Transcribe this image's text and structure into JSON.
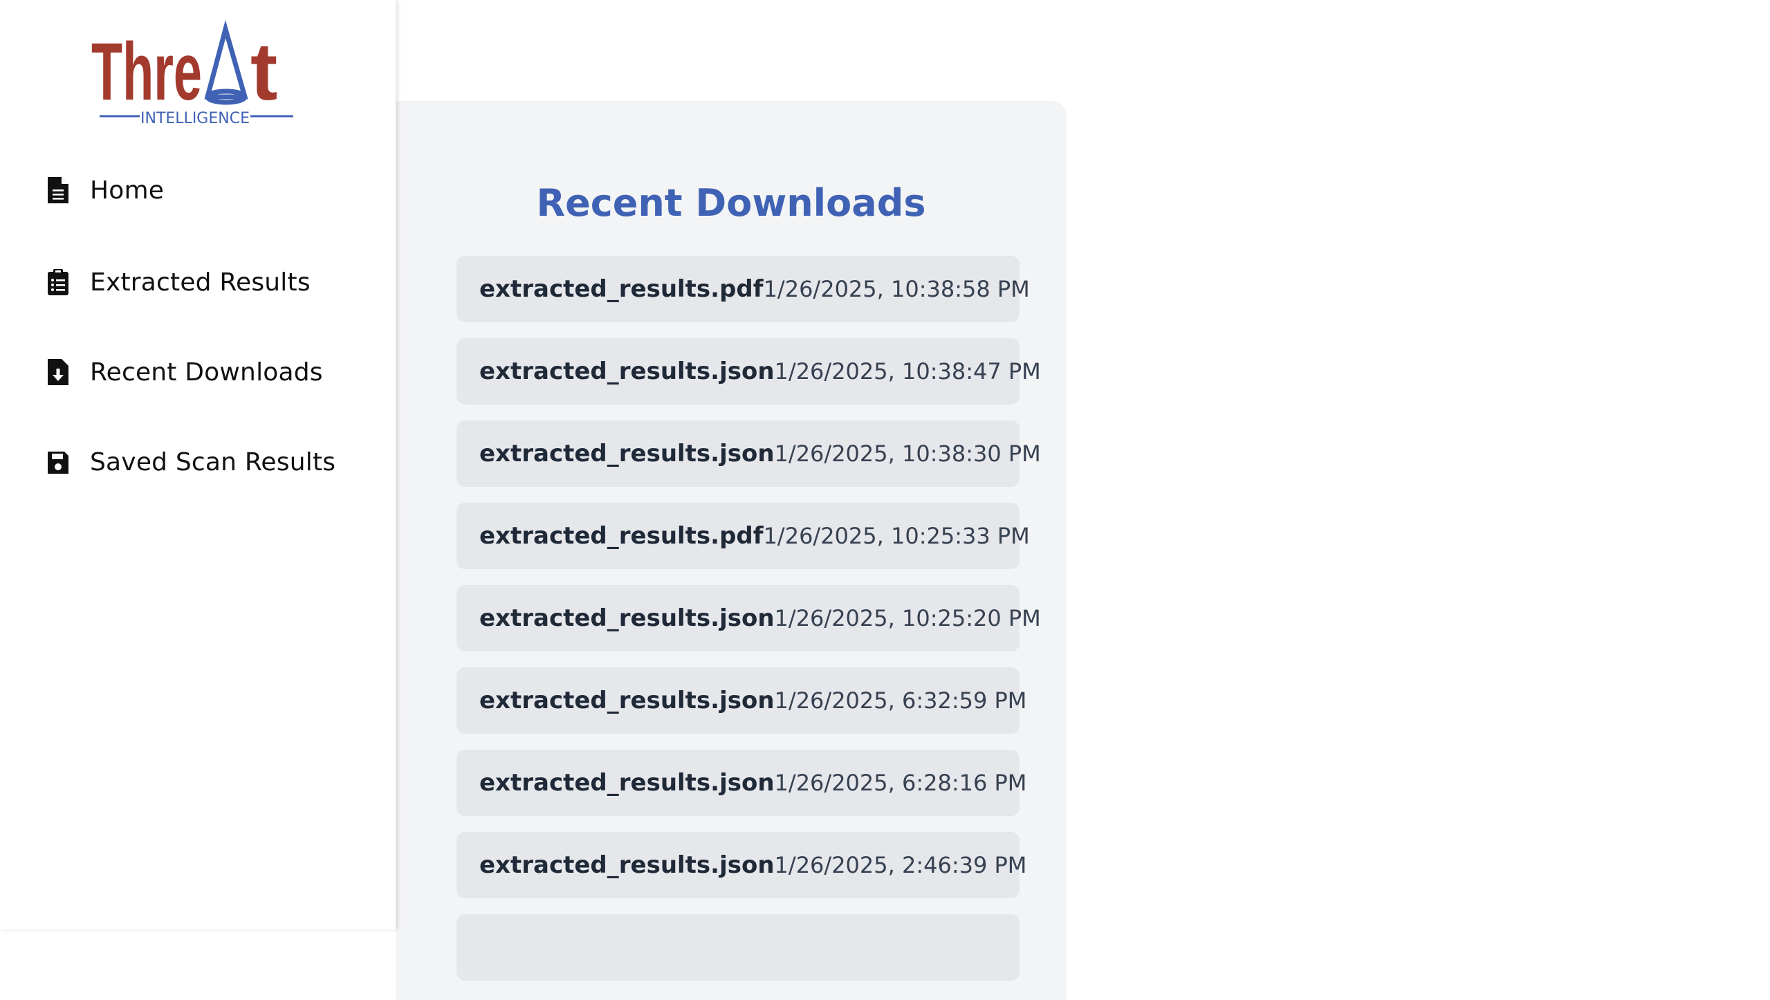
{
  "brand": {
    "logo_text": "Threat",
    "logo_subtext": "INTELLIGENCE",
    "colors": {
      "logo_red": "#a33a2e",
      "logo_blue": "#4062b4"
    }
  },
  "sidebar": {
    "items": [
      {
        "label": "Home",
        "icon": "document-icon"
      },
      {
        "label": "Extracted Results",
        "icon": "clipboard-list-icon"
      },
      {
        "label": "Recent Downloads",
        "icon": "file-download-icon"
      },
      {
        "label": "Saved Scan Results",
        "icon": "floppy-disk-icon"
      }
    ]
  },
  "main": {
    "title": "Recent Downloads",
    "title_color": "#4062b4",
    "downloads": [
      {
        "name": "extracted_results.pdf",
        "date": "1/26/2025, 10:38:58 PM"
      },
      {
        "name": "extracted_results.json",
        "date": "1/26/2025, 10:38:47 PM"
      },
      {
        "name": "extracted_results.json",
        "date": "1/26/2025, 10:38:30 PM"
      },
      {
        "name": "extracted_results.pdf",
        "date": "1/26/2025, 10:25:33 PM"
      },
      {
        "name": "extracted_results.json",
        "date": "1/26/2025, 10:25:20 PM"
      },
      {
        "name": "extracted_results.json",
        "date": "1/26/2025, 6:32:59 PM"
      },
      {
        "name": "extracted_results.json",
        "date": "1/26/2025, 6:28:16 PM"
      },
      {
        "name": "extracted_results.json",
        "date": "1/26/2025, 2:46:39 PM"
      }
    ]
  }
}
